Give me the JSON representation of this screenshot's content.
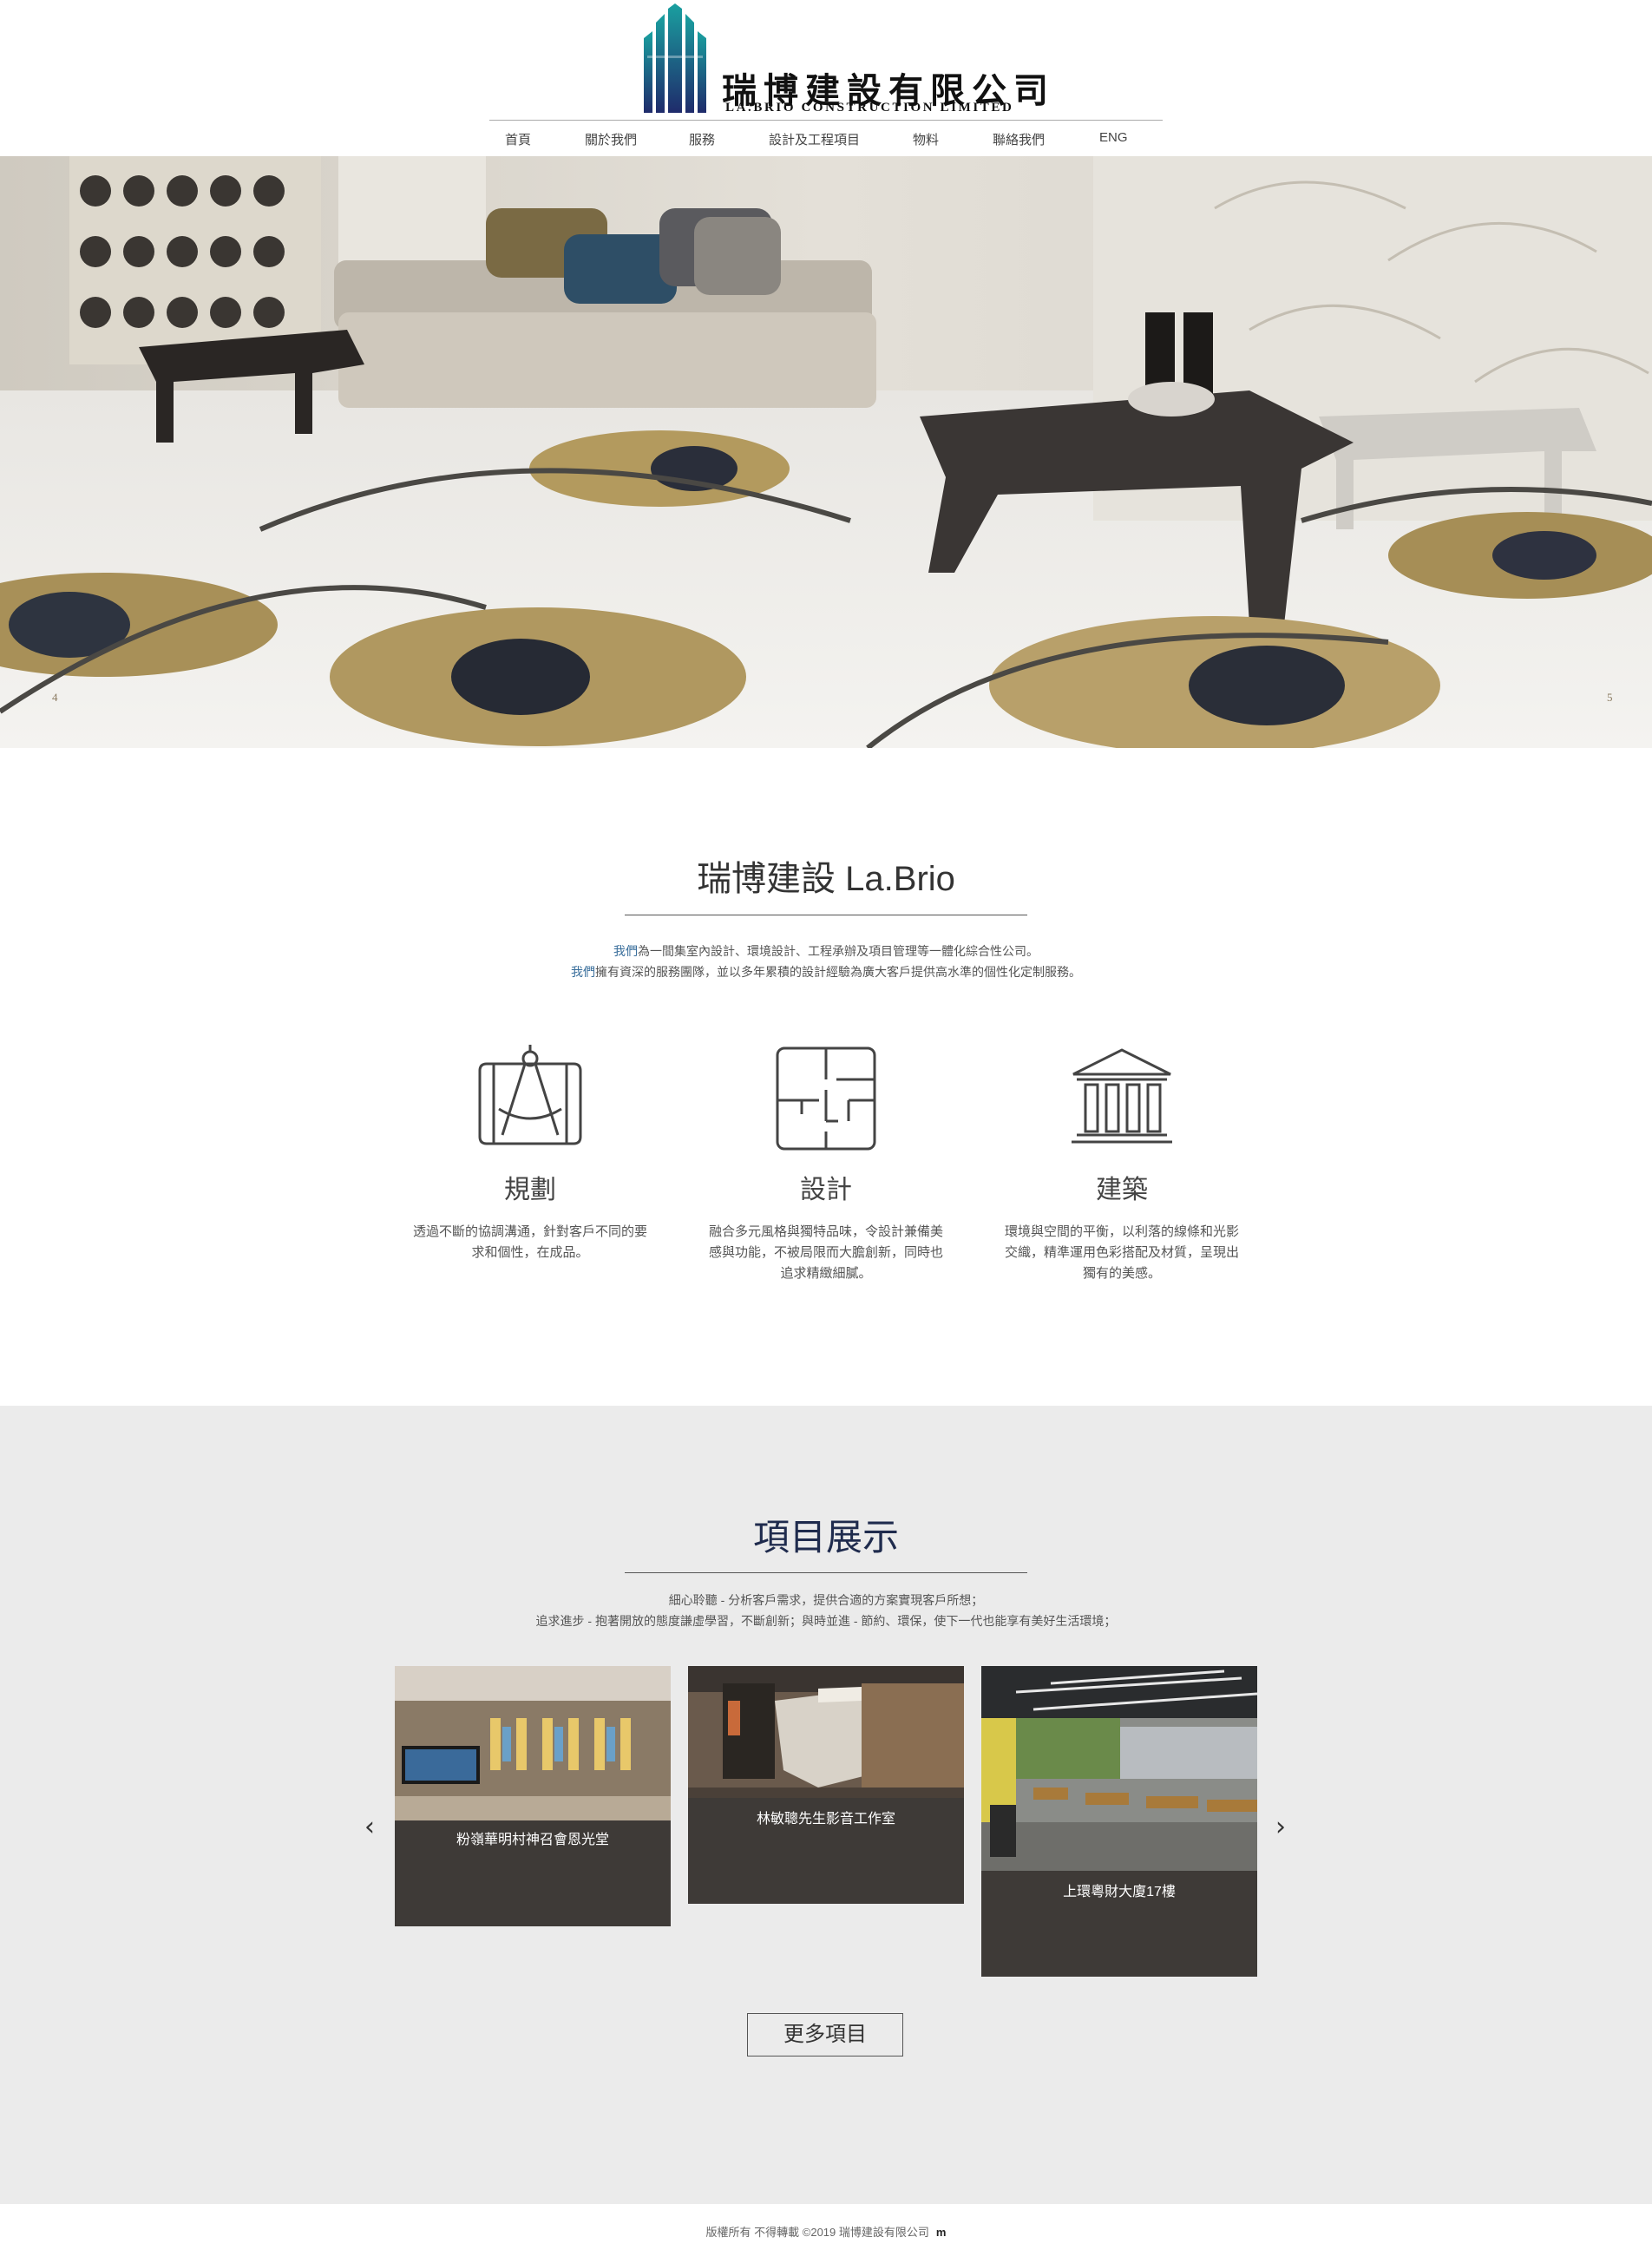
{
  "brand": {
    "name_cn": "瑞博建設有限公司",
    "name_en": "LA.BRIO CONSTRUCTION LIMITED",
    "colors": {
      "mark_teal": "#1a8a8a",
      "mark_navy": "#1f2b6b"
    }
  },
  "nav": {
    "items": [
      {
        "label": "首頁"
      },
      {
        "label": "關於我們"
      },
      {
        "label": "服務"
      },
      {
        "label": "設計及工程項目"
      },
      {
        "label": "物料"
      },
      {
        "label": "聯絡我們"
      },
      {
        "label": "ENG"
      }
    ]
  },
  "hero": {
    "prev_index": "4",
    "next_index": "5"
  },
  "intro": {
    "title": "瑞博建設 La.Brio",
    "line1_highlight": "我們",
    "line1_rest": "為一間集室內設計、環境設計、工程承辦及項目管理等一體化綜合性公司。",
    "line2_highlight": "我們",
    "line2_rest": "擁有資深的服務團隊，並以多年累積的設計經驗為廣大客戶提供高水準的個性化定制服務。"
  },
  "features": [
    {
      "icon": "compass-plan-icon",
      "title": "規劃",
      "text": "透過不斷的協調溝通，針對客戶不同的要求和個性，在成品。"
    },
    {
      "icon": "floor-plan-icon",
      "title": "設計",
      "text": "融合多元風格與獨特品味，令設計兼備美感與功能，不被局限而大膽創新，同時也追求精緻細膩。"
    },
    {
      "icon": "building-icon",
      "title": "建築",
      "text": "環境與空間的平衡，以利落的線條和光影交織，精準運用色彩搭配及材質，呈現出獨有的美感。"
    }
  ],
  "projects": {
    "title": "項目展示",
    "line1": "細心聆聽 - 分析客戶需求，提供合適的方案實現客戶所想；",
    "line2": "追求進步 - 抱著開放的態度謙虛學習，不斷創新；與時並進 - 節約、環保，使下一代也能享有美好生活環境；",
    "items": [
      {
        "label": "粉嶺華明村神召會恩光堂"
      },
      {
        "label": "林敏聰先生影音工作室"
      },
      {
        "label": "上環粵財大廈17樓"
      }
    ],
    "prev_arrow": "‹",
    "next_arrow": "›",
    "more_label": "更多項目"
  },
  "footer": {
    "text": "版權所有 不得轉載 ©2019 瑞博建設有限公司",
    "icon_text": "m"
  }
}
